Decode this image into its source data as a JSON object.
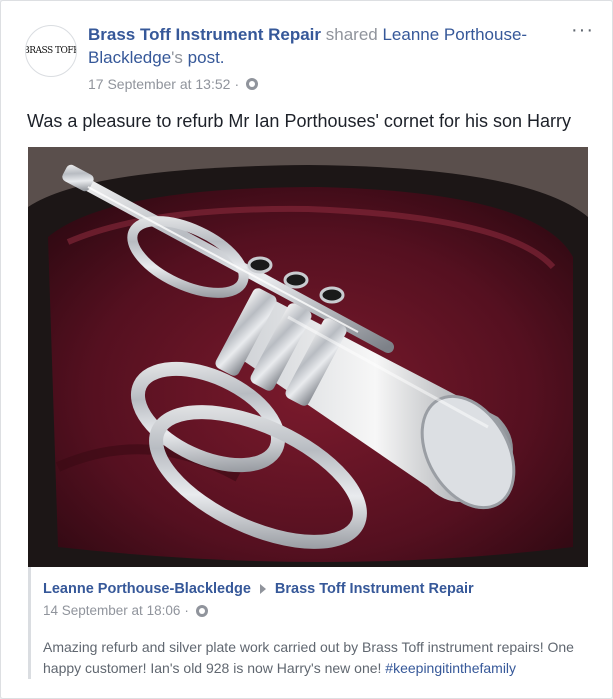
{
  "post": {
    "page_name": "Brass Toff Instrument Repair",
    "shared_word": "shared",
    "shared_from": "Leanne Porthouse-Blackledge",
    "possessive": "'s",
    "post_word": "post.",
    "timestamp": "17 September at 13:52",
    "separator": "·",
    "privacy_icon": "globe-icon",
    "more_icon": "···",
    "text": "Was a pleasure to refurb Mr Ian Porthouses' cornet for his son Harry",
    "avatar_text": "BRASS TOFF"
  },
  "original": {
    "author": "Leanne Porthouse-Blackledge",
    "target": "Brass Toff Instrument Repair",
    "timestamp": "14 September at 18:06",
    "separator": "·",
    "body": "Amazing refurb and silver plate work carried out by Brass Toff instrument repairs! One happy customer! Ian's old 928 is now Harry's new one!",
    "hashtag": "#keepingitinthefamily"
  },
  "colors": {
    "link": "#365899",
    "muted": "#90949c",
    "text": "#1d2129",
    "case_lining": "#5a0f1e"
  }
}
